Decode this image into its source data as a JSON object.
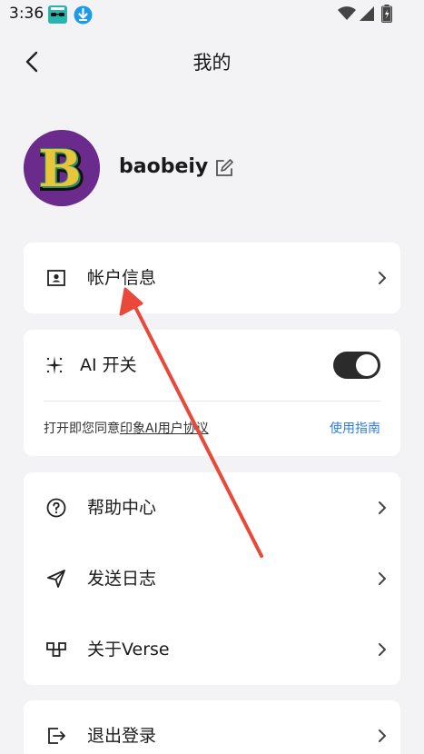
{
  "status_bar": {
    "time": "3:36"
  },
  "header": {
    "title": "我的",
    "back_icon": "chevron-left-icon"
  },
  "profile": {
    "username": "baobeiy",
    "avatar_letter": "B",
    "edit_icon": "edit-icon"
  },
  "account": {
    "label": "帐户信息",
    "icon": "contact-card-icon"
  },
  "ai": {
    "label": "AI 开关",
    "icon": "sparkle-icon",
    "toggle_on": true,
    "agreement_prefix": "打开即您同意",
    "agreement_link": "印象AI用户协议",
    "guide_link": "使用指南"
  },
  "menu": {
    "items": [
      {
        "label": "帮助中心",
        "icon": "help-circle-icon"
      },
      {
        "label": "发送日志",
        "icon": "send-icon"
      },
      {
        "label": "关于Verse",
        "icon": "verse-logo-icon"
      }
    ]
  },
  "logout": {
    "label": "退出登录",
    "icon": "logout-icon"
  },
  "colors": {
    "background": "#f3f3f5",
    "card": "#ffffff",
    "toggle": "#2b2b2b",
    "link": "#2f7de1",
    "annotation": "#e8493a",
    "avatar_bg": "#6a2b8c"
  }
}
